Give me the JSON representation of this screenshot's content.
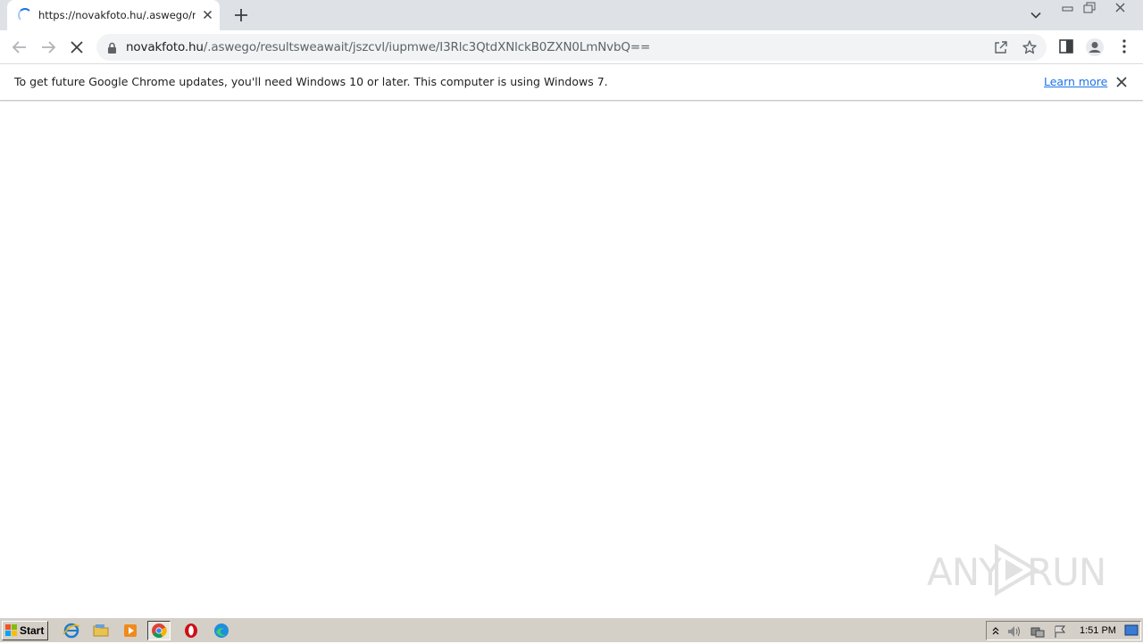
{
  "browser": {
    "tab": {
      "title": "https://novakfoto.hu/.aswego/resul",
      "close_icon": "close-icon",
      "loading_icon": "spinner-icon"
    },
    "new_tab_icon": "plus-icon",
    "url": {
      "domain": "novakfoto.hu",
      "path": "/.aswego/resultsweawait/jszcvl/iupmwe/I3Rlc3QtdXNlckB0ZXN0LmNvbQ=="
    },
    "icons": [
      "back-icon",
      "forward-icon",
      "stop-icon",
      "lock-icon",
      "share-icon",
      "star-icon",
      "side-panel-icon",
      "profile-icon",
      "menu-icon"
    ]
  },
  "infobar": {
    "message": "To get future Google Chrome updates, you'll need Windows 10 or later. This computer is using Windows 7.",
    "link": "Learn more"
  },
  "watermark": {
    "left": "ANY",
    "right": "RUN"
  },
  "taskbar": {
    "start_label": "Start",
    "apps": [
      "ie-icon",
      "folder-icon",
      "media-player-icon",
      "chrome-icon",
      "opera-icon",
      "edge-icon"
    ],
    "clock": "1:51 PM"
  },
  "colors": {
    "accent": "#1a73e8",
    "tabstrip": "#dee1e6",
    "taskbar": "#d4d0c8"
  }
}
